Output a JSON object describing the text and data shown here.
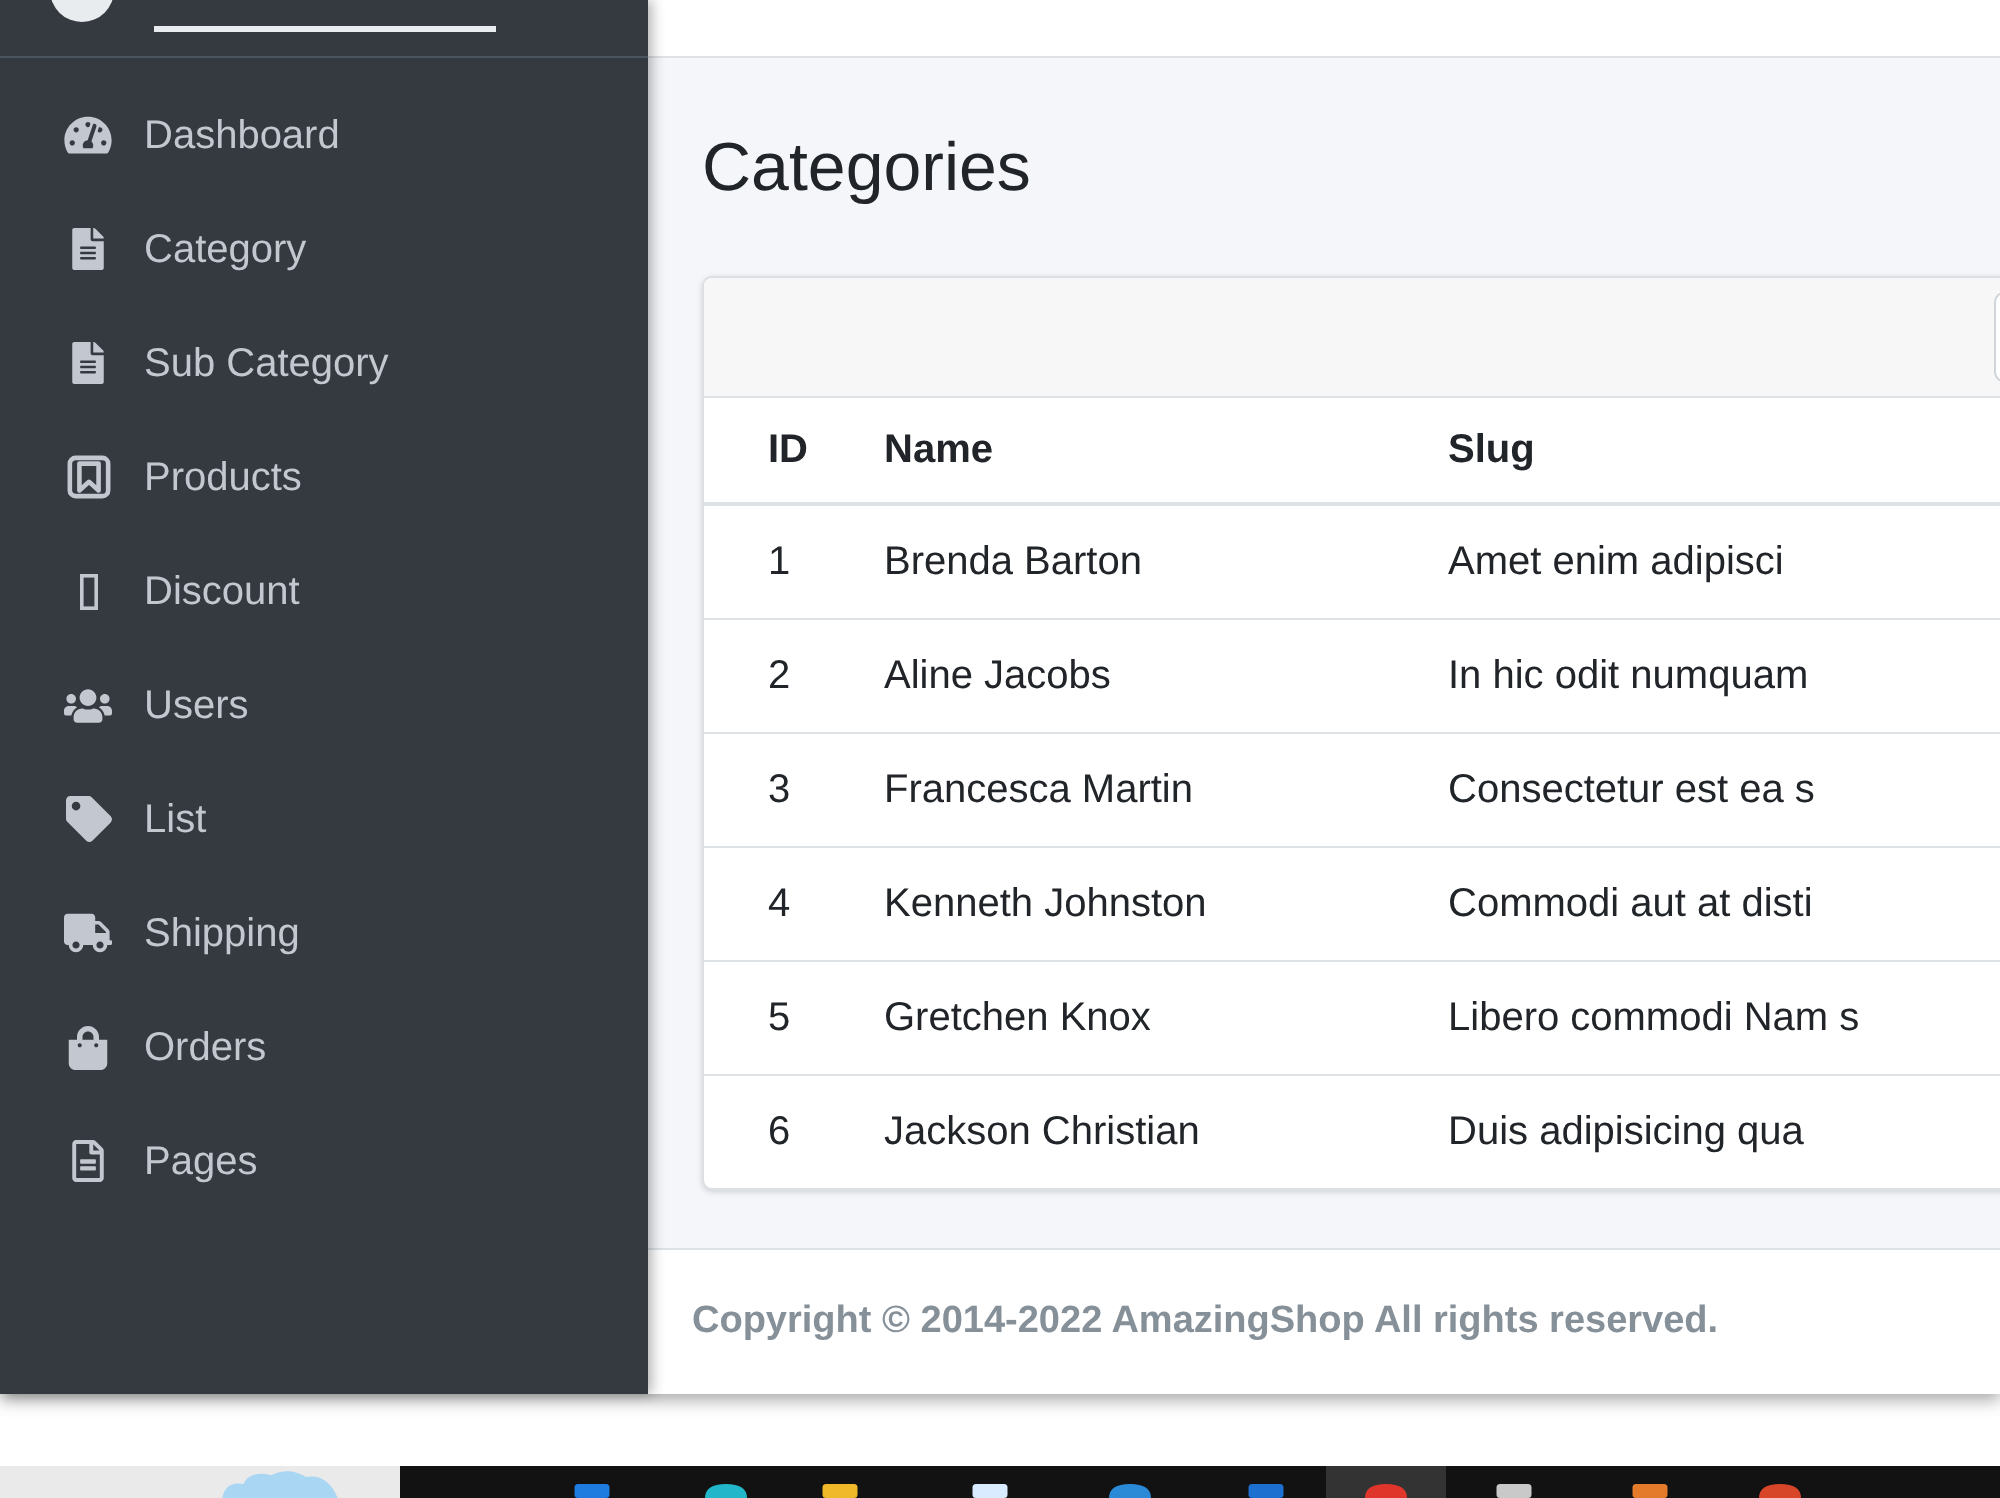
{
  "sidebar": {
    "items": [
      {
        "label": "Dashboard"
      },
      {
        "label": "Category"
      },
      {
        "label": "Sub Category"
      },
      {
        "label": "Products"
      },
      {
        "label": "Discount"
      },
      {
        "label": "Users"
      },
      {
        "label": "List"
      },
      {
        "label": "Shipping"
      },
      {
        "label": "Orders"
      },
      {
        "label": "Pages"
      }
    ]
  },
  "page": {
    "title": "Categories"
  },
  "table": {
    "columns": [
      "ID",
      "Name",
      "Slug"
    ],
    "rows": [
      [
        "1",
        "Brenda Barton",
        "Amet enim adipisci"
      ],
      [
        "2",
        "Aline Jacobs",
        "In hic odit numquam"
      ],
      [
        "3",
        "Francesca Martin",
        "Consectetur est ea s"
      ],
      [
        "4",
        "Kenneth Johnston",
        "Commodi aut at disti"
      ],
      [
        "5",
        "Gretchen Knox",
        "Libero commodi Nam s"
      ],
      [
        "6",
        "Jackson Christian",
        "Duis adipisicing qua"
      ]
    ]
  },
  "footer": {
    "text": "Copyright © 2014-2022 AmazingShop All rights reserved."
  },
  "taskbar": {
    "apps": [
      {
        "selected": false
      },
      {
        "selected": false
      },
      {
        "selected": false
      },
      {
        "selected": false
      },
      {
        "selected": false
      },
      {
        "selected": false
      },
      {
        "selected": true
      },
      {
        "selected": false
      },
      {
        "selected": false
      },
      {
        "selected": false
      }
    ]
  }
}
